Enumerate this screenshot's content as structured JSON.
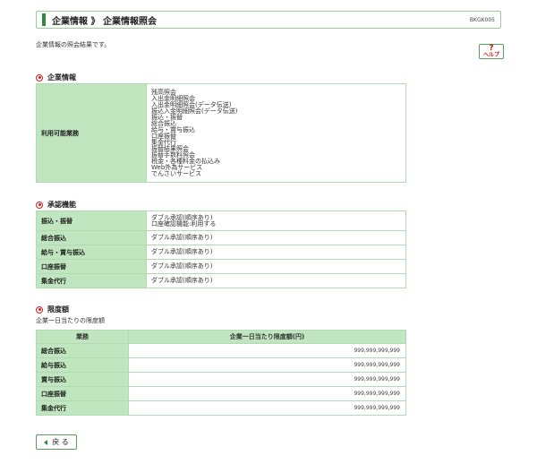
{
  "header": {
    "title": "企業情報 》 企業情報照会",
    "screen_id": "BKGK005"
  },
  "description": "企業情報の照会結果です。",
  "help": {
    "label": "ヘルプ",
    "glyph": "?"
  },
  "company_info": {
    "heading": "企業情報",
    "label": "利用可能業務",
    "functions": [
      "残高照会",
      "入出金明細照会",
      "入出金明細照会(データ伝送)",
      "振込入金明細照会(データ伝送)",
      "振込・振替",
      "総合振込",
      "給与・賞与振込",
      "口座振替",
      "集金代行",
      "振替結果照会",
      "振替手数料照会",
      "税金・各種料金の払込み",
      "Web外為サービス",
      "でんさいサービス"
    ]
  },
  "approval": {
    "heading": "承認機能",
    "rows": [
      {
        "label": "振込・振替",
        "lines": [
          "ダブル承認(順序あり)",
          "口座確認機能:利用する"
        ]
      },
      {
        "label": "総合振込",
        "lines": [
          "ダブル承認(順序あり)"
        ]
      },
      {
        "label": "給与・賞与振込",
        "lines": [
          "ダブル承認(順序あり)"
        ]
      },
      {
        "label": "口座振替",
        "lines": [
          "ダブル承認(順序あり)"
        ]
      },
      {
        "label": "集金代行",
        "lines": [
          "ダブル承認(順序あり)"
        ]
      }
    ]
  },
  "limits": {
    "heading": "限度額",
    "subtext": "企業一日当たりの限度額",
    "col_business": "業務",
    "col_limit": "企業一日当たり限度額(円)",
    "rows": [
      {
        "label": "総合振込",
        "amount": "999,999,999,999"
      },
      {
        "label": "給与振込",
        "amount": "999,999,999,999"
      },
      {
        "label": "賞与振込",
        "amount": "999,999,999,999"
      },
      {
        "label": "口座振替",
        "amount": "999,999,999,999"
      },
      {
        "label": "集金代行",
        "amount": "999,999,999,999"
      }
    ]
  },
  "back_button": {
    "label": "戻 る"
  },
  "colors": {
    "accent": "#2e8b3c",
    "header_fill": "#bfe6bf",
    "border": "#b5d9b5",
    "bullet": "#cc2222"
  }
}
